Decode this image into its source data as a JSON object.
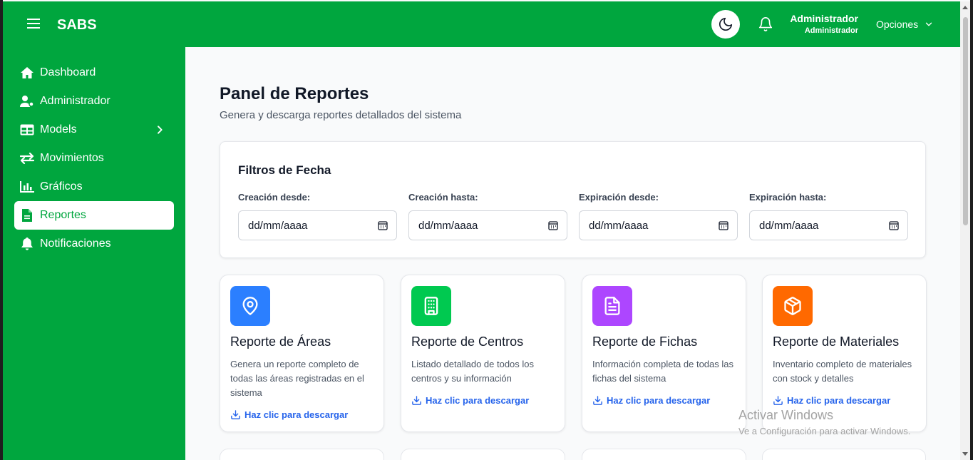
{
  "header": {
    "brand": "SABS",
    "user_name": "Administrador",
    "user_role": "Administrador",
    "options_label": "Opciones",
    "accent": "#00a63e"
  },
  "sidebar": {
    "items": [
      {
        "label": "Dashboard",
        "icon": "home-icon"
      },
      {
        "label": "Administrador",
        "icon": "user-cog-icon"
      },
      {
        "label": "Models",
        "icon": "table-icon"
      },
      {
        "label": "Movimientos",
        "icon": "arrows-icon"
      },
      {
        "label": "Gráficos",
        "icon": "bar-chart-icon"
      },
      {
        "label": "Reportes",
        "icon": "file-icon"
      },
      {
        "label": "Notificaciones",
        "icon": "bell-icon"
      }
    ],
    "active": "Reportes"
  },
  "main": {
    "title": "Panel de Reportes",
    "subtitle": "Genera y descarga reportes detallados del sistema",
    "filters": {
      "title": "Filtros de Fecha",
      "fields": [
        {
          "label": "Creación desde:",
          "placeholder": "dd/mm/aaaa"
        },
        {
          "label": "Creación hasta:",
          "placeholder": "dd/mm/aaaa"
        },
        {
          "label": "Expiración desde:",
          "placeholder": "dd/mm/aaaa"
        },
        {
          "label": "Expiración hasta:",
          "placeholder": "dd/mm/aaaa"
        }
      ]
    },
    "cards": [
      {
        "title": "Reporte de Áreas",
        "description": "Genera un reporte completo de todas las áreas registradas en el sistema",
        "link": "Haz clic para descargar",
        "icon": "map-pin-icon",
        "color": "#2b7fff"
      },
      {
        "title": "Reporte de Centros",
        "description": "Listado detallado de todos los centros y su información",
        "link": "Haz clic para descargar",
        "icon": "building-icon",
        "color": "#00c950"
      },
      {
        "title": "Reporte de Fichas",
        "description": "Información completa de todas las fichas del sistema",
        "link": "Haz clic para descargar",
        "icon": "document-icon",
        "color": "#ad46ff"
      },
      {
        "title": "Reporte de Materiales",
        "description": "Inventario completo de materiales con stock y detalles",
        "link": "Haz clic para descargar",
        "icon": "package-icon",
        "color": "#ff6900"
      }
    ]
  },
  "watermark": {
    "title": "Activar Windows",
    "subtitle": "Ve a Configuración para activar Windows."
  }
}
